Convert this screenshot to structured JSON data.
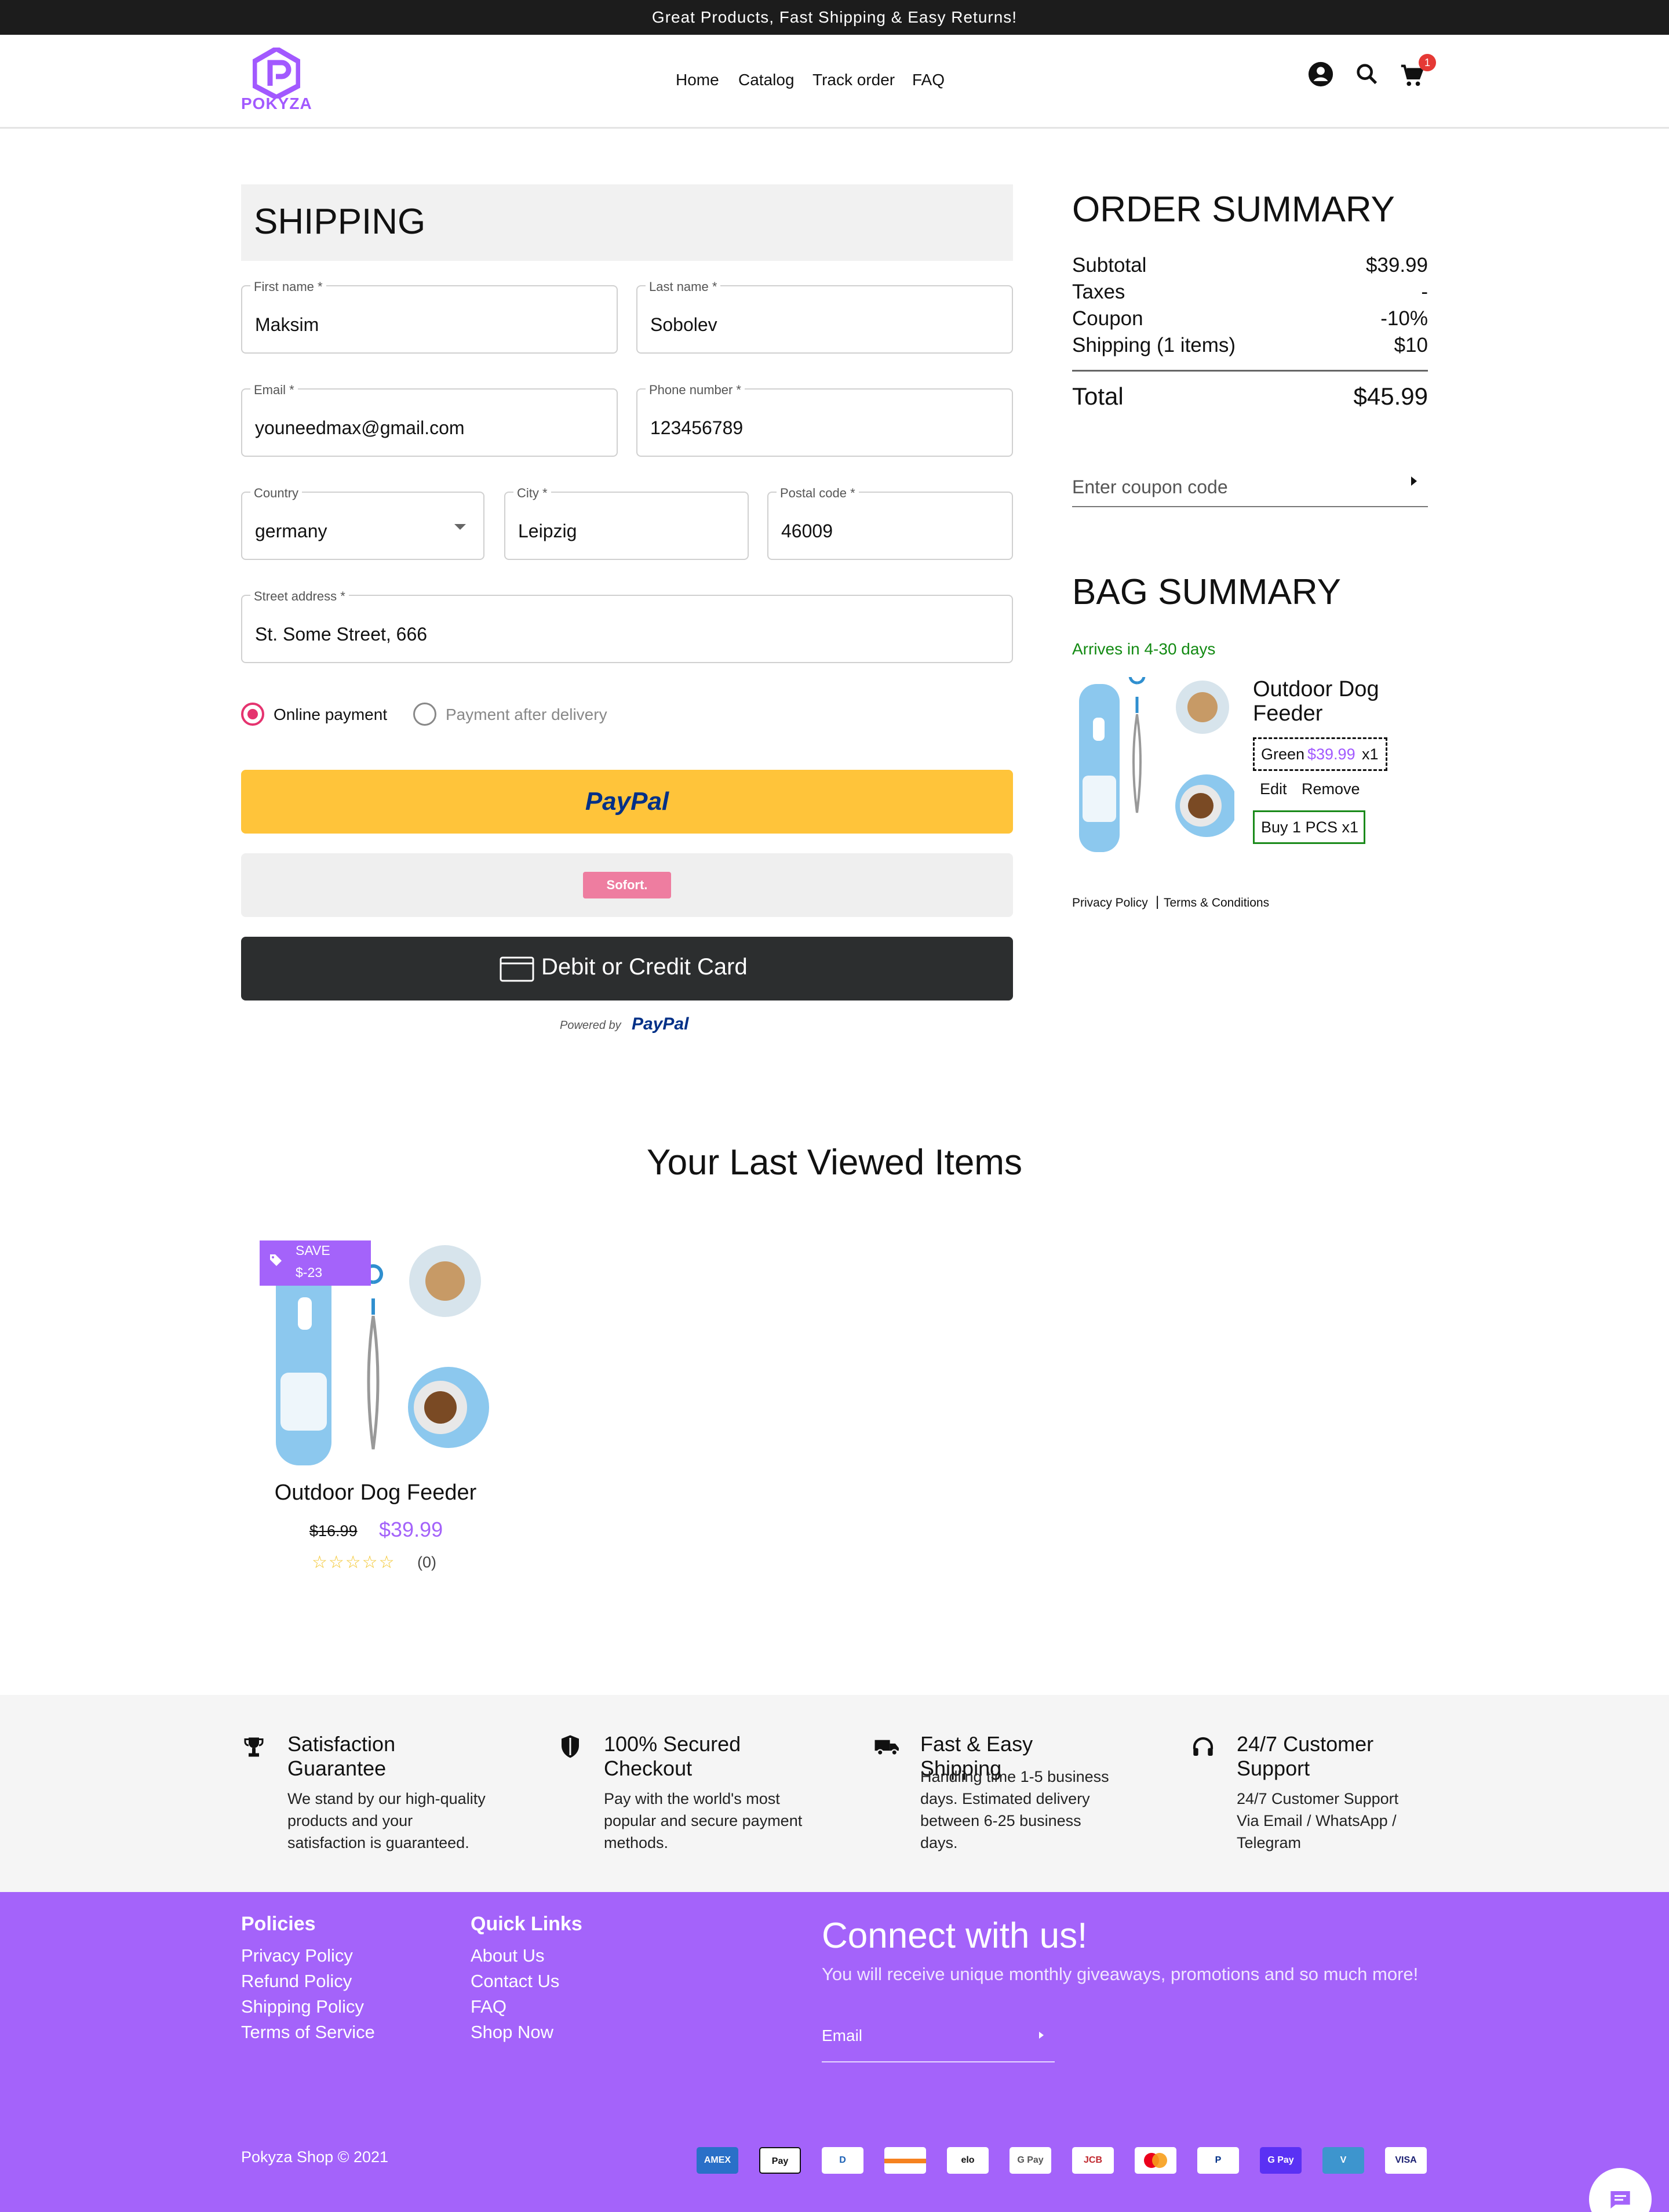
{
  "topbar": {
    "text": "Great  Products,  Fast  Shipping  &  Easy  Returns!"
  },
  "brand": {
    "name": "POKYZA",
    "color": "#a259ff"
  },
  "nav": {
    "items": [
      "Home",
      "Catalog",
      "Track order",
      "FAQ"
    ]
  },
  "header_icons": {
    "account": "account-circle-icon",
    "search": "search-icon",
    "cart": "cart-icon",
    "cart_count": "1"
  },
  "shipping": {
    "title": "SHIPPING",
    "fields": {
      "first_name": {
        "label": "First name *",
        "value": "Maksim"
      },
      "last_name": {
        "label": "Last name *",
        "value": "Sobolev"
      },
      "email": {
        "label": "Email *",
        "value": "youneedmax@gmail.com"
      },
      "phone": {
        "label": "Phone number *",
        "value": "123456789"
      },
      "country": {
        "label": "Country",
        "value": "germany"
      },
      "city": {
        "label": "City *",
        "value": "Leipzig"
      },
      "postal": {
        "label": "Postal code *",
        "value": "46009"
      },
      "street": {
        "label": "Street address *",
        "value": "St. Some Street, 666"
      }
    },
    "payment_options": {
      "online": "Online payment",
      "after_delivery": "Payment after delivery",
      "selected": "online"
    },
    "buttons": {
      "paypal": "PayPal",
      "sofort": "Sofort.",
      "card": "Debit or Credit Card",
      "powered_by": "Powered by",
      "powered_brand": "PayPal"
    }
  },
  "order_summary": {
    "title": "ORDER SUMMARY",
    "rows": [
      {
        "label": "Subtotal",
        "value": "$39.99"
      },
      {
        "label": "Taxes",
        "value": "-"
      },
      {
        "label": "Coupon",
        "value": "-10%"
      },
      {
        "label": "Shipping (1 items)",
        "value": "$10"
      }
    ],
    "total_label": "Total",
    "total_value": "$45.99",
    "coupon_placeholder": "Enter coupon code"
  },
  "bag_summary": {
    "title": "BAG SUMMARY",
    "arrives": "Arrives in 4-30 days",
    "item": {
      "name": "Outdoor Dog Feeder",
      "variant": "Green",
      "price": "$39.99",
      "qty": "x1",
      "edit": "Edit",
      "remove": "Remove",
      "bundle": "Buy 1 PCS x1"
    },
    "links": {
      "privacy": "Privacy Policy",
      "separator": "|",
      "terms": "Terms & Conditions"
    }
  },
  "last_viewed": {
    "title": "Your Last Viewed Items",
    "items": [
      {
        "save_label": "SAVE",
        "save_amount": "$-23",
        "name": "Outdoor Dog Feeder",
        "old_price": "$16.99",
        "price": "$39.99",
        "reviews": "(0)",
        "stars": 5
      }
    ]
  },
  "features": [
    {
      "icon": "trophy-icon",
      "title": "Satisfaction Guarantee",
      "desc": "We stand by our high-quality products and your satisfaction is guaranteed."
    },
    {
      "icon": "shield-icon",
      "title": "100% Secured Checkout",
      "desc": "Pay with the world's most popular and secure payment methods."
    },
    {
      "icon": "truck-icon",
      "title": "Fast & Easy Shipping",
      "desc": "Handling time 1-5 business days. Estimated delivery between 6-25 business days."
    },
    {
      "icon": "headset-icon",
      "title": "24/7 Customer Support",
      "desc": "24/7 Customer Support Via Email / WhatsApp / Telegram"
    }
  ],
  "footer": {
    "policies_title": "Policies",
    "policies": [
      "Privacy Policy",
      "Refund Policy",
      "Shipping Policy",
      "Terms of Service"
    ],
    "quick_title": "Quick Links",
    "quick": [
      "About Us",
      "Contact Us",
      "FAQ",
      "Shop Now"
    ],
    "connect_title": "Connect with us!",
    "connect_sub": "You will receive unique monthly giveaways, promotions and so much more!",
    "email_placeholder": "Email",
    "copyright": "Pokyza Shop © 2021",
    "payment_icons": [
      "AMEX",
      "Pay",
      "D",
      "",
      "elo",
      "G Pay",
      "JCB",
      "",
      "P",
      "G Pay",
      "V",
      "VISA"
    ]
  }
}
